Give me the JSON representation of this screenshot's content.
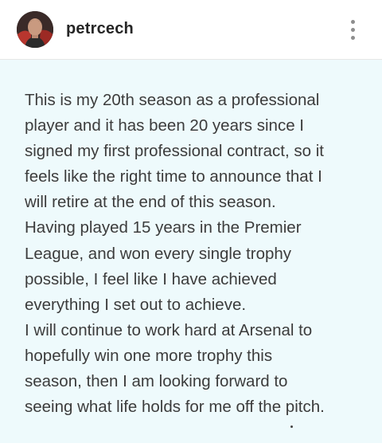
{
  "header": {
    "username": "petrcech",
    "avatar_icon": "profile-photo",
    "more_icon": "vertical-ellipsis-icon"
  },
  "post": {
    "text": "This is my 20th season as a professional\nplayer and it has been 20 years since I\nsigned my first professional contract, so it\nfeels like the right time to announce that I\nwill retire at the end of this season.\nHaving played 15 years in the Premier\nLeague, and won every single trophy\npossible, I feel like I have achieved\neverything I set out to achieve.\nI will continue to work hard at Arsenal to\nhopefully win one more trophy this\nseason, then I am looking forward to\nseeing what life holds for me off the pitch.",
    "background_color": "#eefafc",
    "text_color": "#3c3c3c"
  }
}
